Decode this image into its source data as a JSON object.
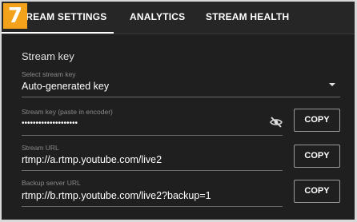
{
  "badge": {
    "number": "7",
    "color": "#f2a21b"
  },
  "tabs": [
    {
      "label": "STREAM SETTINGS",
      "active": true
    },
    {
      "label": "ANALYTICS",
      "active": false
    },
    {
      "label": "STREAM HEALTH",
      "active": false
    }
  ],
  "stream_key_section": {
    "title": "Stream key",
    "select": {
      "label": "Select stream key",
      "value": "Auto-generated key",
      "icon": "dropdown-arrow-icon"
    },
    "key_field": {
      "label": "Stream key (paste in encoder)",
      "value": "••••••••••••••••••••",
      "icon": "eye-off-icon",
      "copy_label": "COPY"
    },
    "url_field": {
      "label": "Stream URL",
      "value": "rtmp://a.rtmp.youtube.com/live2",
      "copy_label": "COPY"
    },
    "backup_field": {
      "label": "Backup server URL",
      "value": "rtmp://b.rtmp.youtube.com/live2?backup=1",
      "copy_label": "COPY"
    }
  }
}
